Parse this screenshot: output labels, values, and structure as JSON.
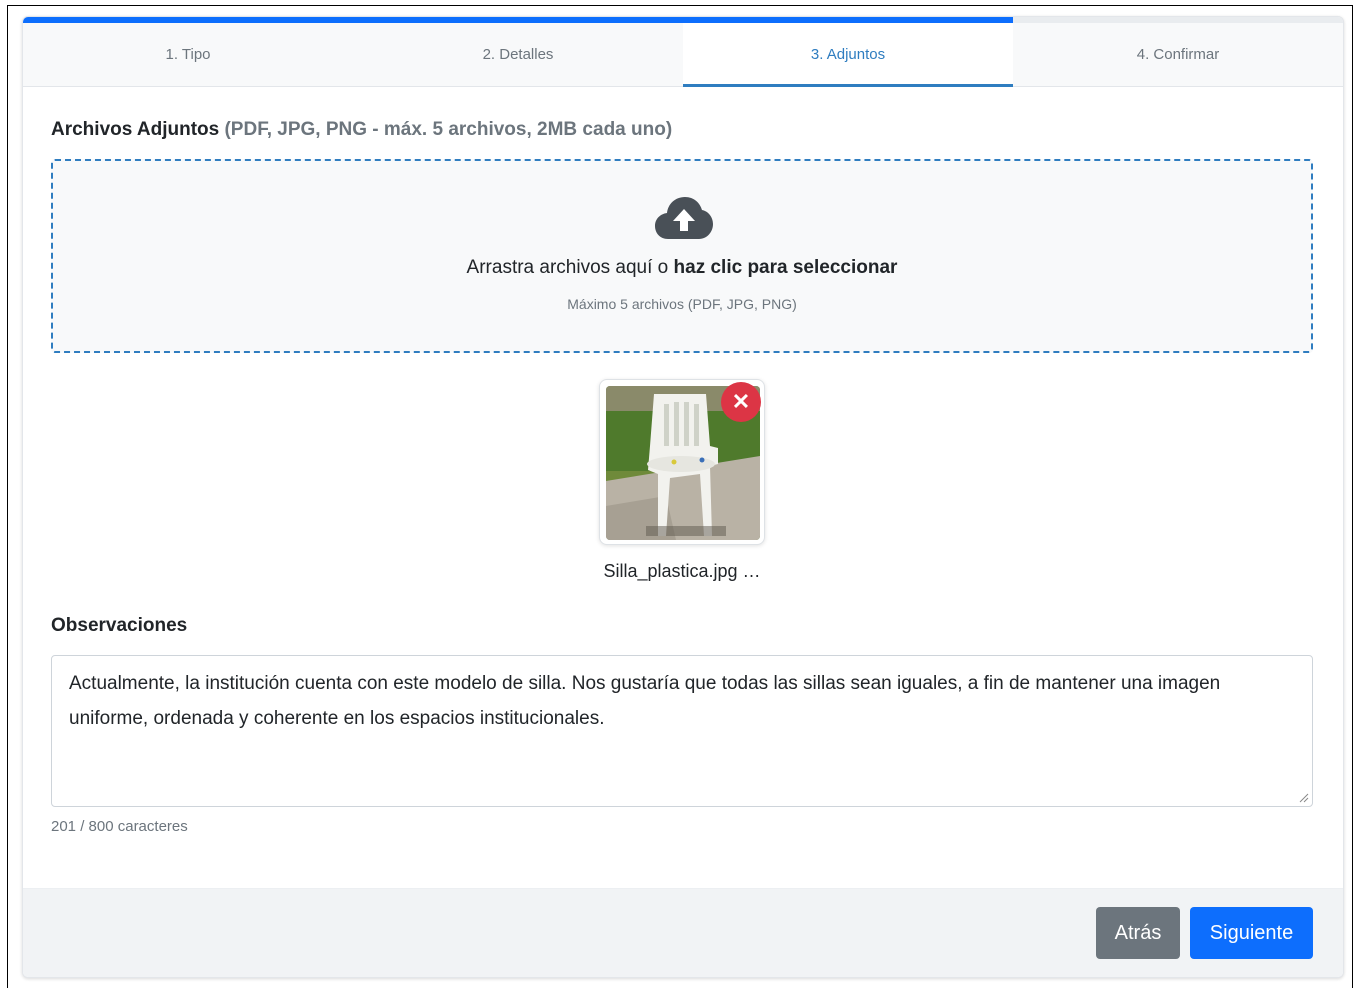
{
  "progress": {
    "fraction": 0.75,
    "color": "#0d6efd"
  },
  "tabs": [
    {
      "label": "1. Tipo",
      "active": false
    },
    {
      "label": "2. Detalles",
      "active": false
    },
    {
      "label": "3. Adjuntos",
      "active": true
    },
    {
      "label": "4. Confirmar",
      "active": false
    }
  ],
  "attachments": {
    "title": "Archivos Adjuntos",
    "hint": "(PDF, JPG, PNG - máx. 5 archivos, 2MB cada uno)",
    "dropzone": {
      "icon": "cloud-upload-icon",
      "text_plain": "Arrastra archivos aquí o",
      "text_bold": "haz clic para seleccionar",
      "subtext": "Máximo 5 archivos (PDF, JPG, PNG)"
    },
    "files": [
      {
        "name": "Silla_plastica.jpg …",
        "remove_icon": "close-icon"
      }
    ]
  },
  "observations": {
    "label": "Observaciones",
    "value": "Actualmente, la institución cuenta con este modelo de silla. Nos gustaría que todas las sillas sean iguales, a fin de mantener una imagen uniforme, ordenada y coherente en los espacios institucionales.",
    "counter": "201 / 800 caracteres"
  },
  "footer": {
    "back_label": "Atrás",
    "next_label": "Siguiente"
  },
  "colors": {
    "accent": "#2f7dc0",
    "primary": "#0d6efd",
    "secondary": "#6c757d",
    "danger": "#dc3545"
  }
}
